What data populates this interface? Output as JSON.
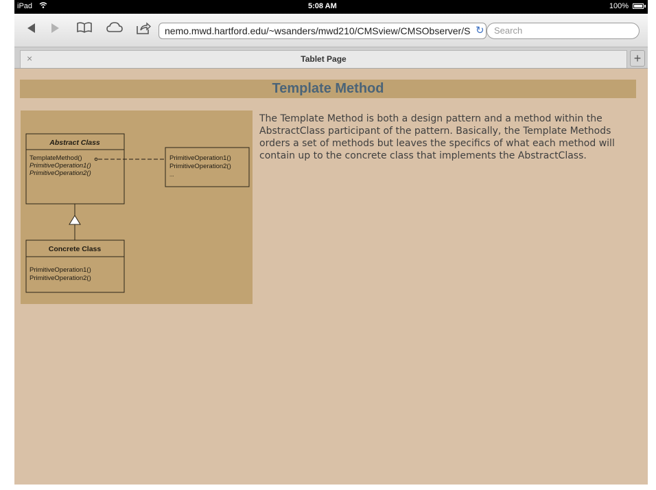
{
  "status": {
    "carrier": "iPad",
    "time": "5:08 AM",
    "battery": "100%"
  },
  "toolbar": {
    "url": "nemo.mwd.hartford.edu/~wsanders/mwd210/CMSview/CMSObserver/S",
    "search_placeholder": "Search",
    "icons": [
      "back-icon",
      "forward-icon",
      "bookmarks-icon",
      "icloud-icon",
      "share-icon",
      "reload-icon"
    ]
  },
  "tab": {
    "title": "Tablet Page",
    "close": "×",
    "add": "+"
  },
  "page": {
    "heading": "Template Method",
    "description": "The Template Method is both a design pattern and a method within the AbstractClass participant of the pattern. Basically, the Template Methods orders a set of methods but leaves the specifics of what each method will contain up to the concrete class that implements the AbstractClass."
  },
  "diagram": {
    "abstract_class": {
      "title": "Abstract Class",
      "op1": "TemplateMethod()",
      "op2": "PrimitiveOperation1()",
      "op3": "PrimitiveOperation2()"
    },
    "note": {
      "line1": "PrimitiveOperation1()",
      "line2": "PrimitiveOperation2()",
      "line3": "..."
    },
    "concrete_class": {
      "title": "Concrete Class",
      "op1": "PrimitiveOperation1()",
      "op2": "PrimitiveOperation2()"
    }
  },
  "colors": {
    "page_bg": "#d9c1a7",
    "heading_bar": "#bfa272",
    "heading_text": "#4b6478",
    "figure_bg": "#c1a372"
  }
}
